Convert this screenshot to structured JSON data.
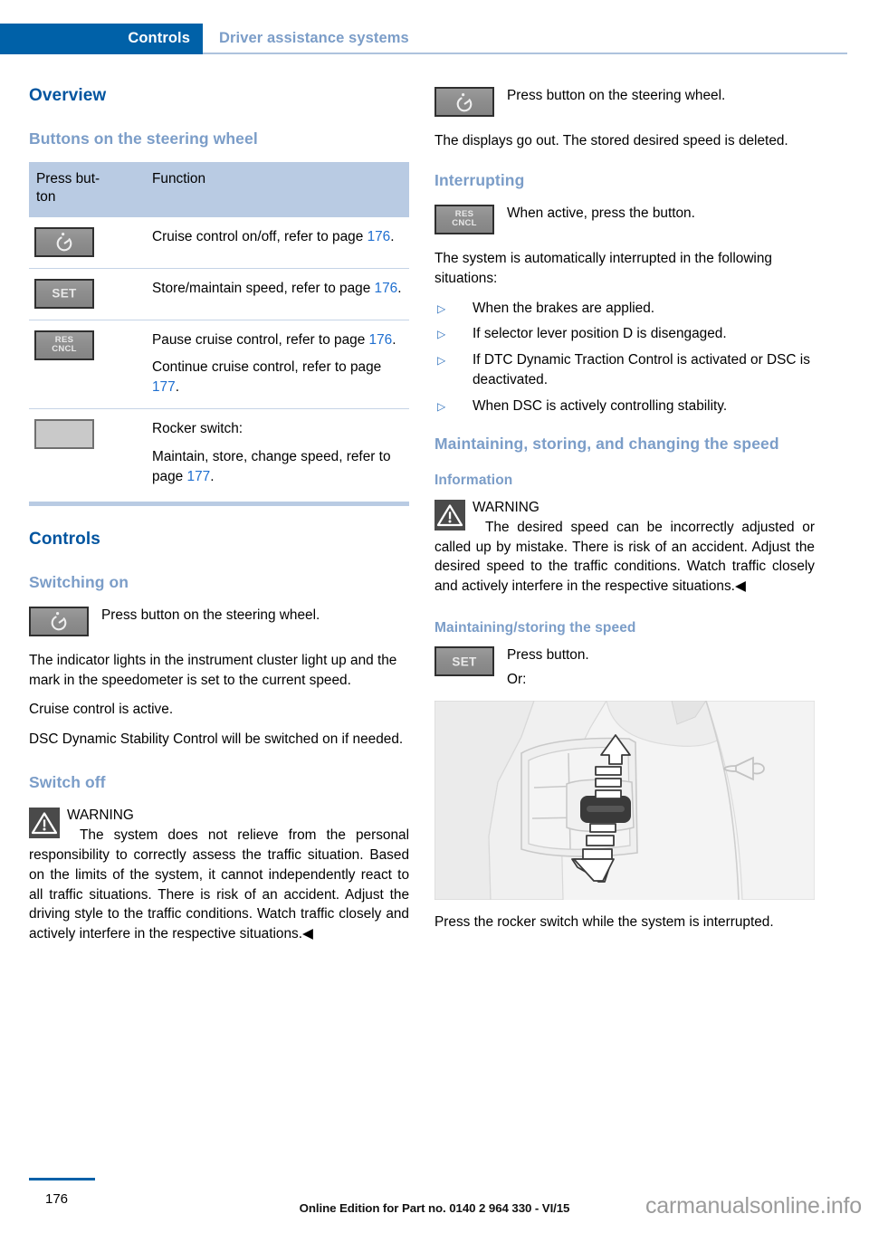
{
  "header": {
    "tab_label": "Controls",
    "section_label": "Driver assistance systems"
  },
  "left_column": {
    "overview_heading": "Overview",
    "buttons_heading": "Buttons on the steering wheel",
    "table": {
      "columns": [
        "Press but-\nton",
        "Function"
      ],
      "col1_header": "Press but-ton",
      "col2_header": "Function",
      "rows": [
        {
          "icon": "cruise-control-button",
          "icon_label": "",
          "lines": [
            {
              "text_before": "Cruise control on/off, refer to page ",
              "page": "176",
              "text_after": "."
            }
          ]
        },
        {
          "icon": "set-button",
          "icon_label": "SET",
          "lines": [
            {
              "text_before": "Store/maintain speed, refer to page ",
              "page": "176",
              "text_after": "."
            }
          ]
        },
        {
          "icon": "res-cncl-button",
          "icon_label": "RES CNCL",
          "lines": [
            {
              "text_before": "Pause cruise control, refer to page ",
              "page": "176",
              "text_after": "."
            },
            {
              "text_before": "Continue cruise control, refer to page ",
              "page": "177",
              "text_after": "."
            }
          ]
        },
        {
          "icon": "rocker-switch",
          "icon_label": "",
          "lines": [
            {
              "text_before": "Rocker switch:",
              "page": "",
              "text_after": ""
            },
            {
              "text_before": "Maintain, store, change speed, refer to page ",
              "page": "177",
              "text_after": "."
            }
          ]
        }
      ]
    },
    "controls_heading": "Controls",
    "switching_on_heading": "Switching on",
    "switching_on_icon_text": "Press button on the steering wheel.",
    "switching_on_p1": "The indicator lights in the instrument cluster light up and the mark in the speedometer is set to the current speed.",
    "switching_on_p2": "Cruise control is active.",
    "switching_on_p3": "DSC Dynamic Stability Control will be switched on if needed.",
    "switch_off_heading": "Switch off",
    "warning_label": "WARNING",
    "warning_text": "The system does not relieve from the personal responsibility to correctly assess the traffic situation. Based on the limits of the system, it cannot independently react to all traffic situations. There is risk of an accident. Adjust the driving style to the traffic conditions. Watch traffic closely and actively interfere in the respective situations.",
    "warning_endmark": "◀"
  },
  "right_column": {
    "switch_off_icon_text": "Press button on the steering wheel.",
    "switch_off_p1": "The displays go out. The stored desired speed is deleted.",
    "interrupting_heading": "Interrupting",
    "interrupting_icon_text": "When active, press the button.",
    "interrupting_p1": "The system is automatically interrupted in the following situations:",
    "bullets": [
      "When the brakes are applied.",
      "If selector lever position D is disengaged.",
      "If DTC Dynamic Traction Control is activated or DSC is deactivated.",
      "When DSC is actively controlling stability."
    ],
    "maintaining_heading": "Maintaining, storing, and changing the speed",
    "information_heading": "Information",
    "warning_label": "WARNING",
    "warning_text": "The desired speed can be incorrectly adjusted or called up by mistake. There is risk of an accident. Adjust the desired speed to the traffic conditions. Watch traffic closely and actively interfere in the respective situations.",
    "warning_endmark": "◀",
    "maintaining_storing_heading": "Maintaining/storing the speed",
    "set_icon_text": "Press button.",
    "or_text": "Or:",
    "photo_alt": "steering-wheel-rocker-switch-photo",
    "photo_caption": "Press the rocker switch while the system is interrupted."
  },
  "footer": {
    "page_number": "176",
    "edition_text": "Online Edition for Part no. 0140 2 964 330 - VI/15",
    "watermark": "carmanualsonline.info"
  },
  "icons": {
    "set_label": "SET",
    "res_label": "RES",
    "cncl_label": "CNCL",
    "cruise_icon_name": "cruise-control-speedometer-icon",
    "rocker_icon_name": "rocker-switch-icon",
    "warning_icon_name": "warning-triangle-icon",
    "bullet_glyph": "▷",
    "horn_icon_name": "horn-icon"
  },
  "colors": {
    "header_blue": "#0061a8",
    "heading_blue": "#00549f",
    "subheading_blue": "#7b9dc8",
    "link_blue": "#1f6fd0",
    "table_header_bg": "#b9cbe3",
    "rule_blue": "#c5d3e6"
  }
}
